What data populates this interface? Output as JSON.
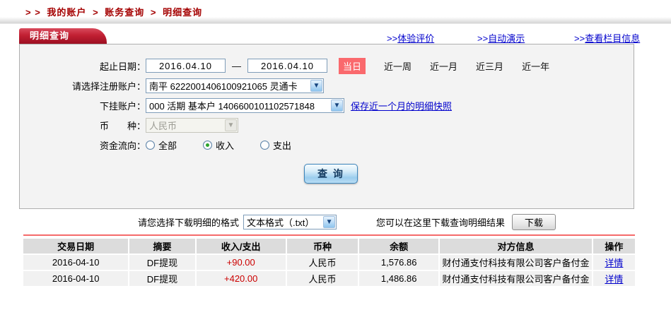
{
  "breadcrumb": {
    "prefix": "> >",
    "separator": ">",
    "items": [
      "我的账户",
      "账务查询",
      "明细查询"
    ]
  },
  "header": {
    "tab_label": "明细查询",
    "links": [
      {
        "prefix": ">>",
        "label": "体验评价"
      },
      {
        "prefix": ">>",
        "label": "自动演示"
      },
      {
        "prefix": ">>",
        "label": "查看栏目信息"
      }
    ]
  },
  "form": {
    "date_range": {
      "label": "起止日期：",
      "start": "2016.04.10",
      "end": "2016.04.10",
      "dash": "—",
      "today_badge": "当日",
      "quick_options": [
        "近一周",
        "近一月",
        "近三月",
        "近一年"
      ]
    },
    "register_account": {
      "label": "请选择注册账户：",
      "value": "南平 6222001406100921065 灵通卡"
    },
    "sub_account": {
      "label": "下挂账户：",
      "value": "000 活期 基本户 1406600101102571848",
      "snapshot_link": "保存近一个月的明细快照"
    },
    "currency": {
      "label": "币　　种：",
      "value": "人民币"
    },
    "flow": {
      "label": "资金流向：",
      "options": [
        {
          "label": "全部",
          "selected": false
        },
        {
          "label": "收入",
          "selected": true
        },
        {
          "label": "支出",
          "selected": false
        }
      ]
    },
    "query_button": "查 询"
  },
  "download": {
    "format_label": "请您选择下载明细的格式",
    "format_value": "文本格式（.txt）",
    "result_label": "您可以在这里下载查询明细结果",
    "button_label": "下载"
  },
  "table": {
    "headers": [
      "交易日期",
      "摘要",
      "收入/支出",
      "币种",
      "余额",
      "对方信息",
      "操作"
    ],
    "rows": [
      {
        "date": "2016-04-10",
        "summary": "DF提现",
        "amount": "+90.00",
        "currency": "人民币",
        "balance": "1,576.86",
        "counterparty": "财付通支付科技有限公司客户备付金",
        "action": "详情"
      },
      {
        "date": "2016-04-10",
        "summary": "DF提现",
        "amount": "+420.00",
        "currency": "人民币",
        "balance": "1,486.86",
        "counterparty": "财付通支付科技有限公司客户备付金",
        "action": "详情"
      }
    ]
  },
  "colors": {
    "tab_red": "#c22033",
    "breadcrumb_red": "#a40000",
    "link_blue": "#0000cc",
    "today_badge_red": "#fa696d",
    "amount_red": "#cc0000",
    "divider_red": "#f56b6b",
    "panel_bg": "#f3f3f3",
    "table_header_bg": "#dcdcdc",
    "table_row_bg": "#f1f1f1"
  }
}
